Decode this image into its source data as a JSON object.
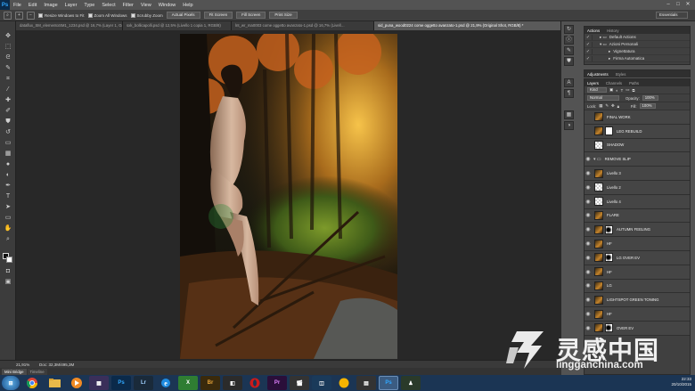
{
  "app": {
    "logo": "Ps"
  },
  "menu": [
    "File",
    "Edit",
    "Image",
    "Layer",
    "Type",
    "Select",
    "Filter",
    "View",
    "Window",
    "Help"
  ],
  "window_controls": {
    "minimize": "–",
    "maximize": "□",
    "close": "✕"
  },
  "options": {
    "resize_label": "Resize Windows to Fit",
    "zoom_all_label": "Zoom All Windows",
    "scrubby_label": "Scrubby Zoom",
    "actual_pixels": "Actual Pixels",
    "fit_screen": "Fit Screen",
    "fill_screen": "Fill Screen",
    "print_size": "Print Size",
    "workspace": "Essentials"
  },
  "tabs": [
    {
      "label": "dataflux_SM_elementoSM1_1234.psd @ 16,7% (Layer 1, Gray/8)",
      "active": false
    },
    {
      "label": "sxk_bollicapolli.psd @ 12,5% (Livello 1 copia 1, RGB/8)",
      "active": false
    },
    {
      "label": "lnt_wr_ma0003 come oggetto avanzato-1.psd @ 16,7% (Livell…",
      "active": false
    },
    {
      "label": "sid_puna_wood0224 come oggetto avanzato-1.psd @ 21,9% (Original Shot, RGB/8) *",
      "active": true
    }
  ],
  "status": {
    "zoom": "21,91%",
    "doc": "Doc: 32,3M/495,3M"
  },
  "bottom_tabs": [
    {
      "label": "Mini Bridge",
      "active": true
    },
    {
      "label": "Timeline",
      "active": false
    }
  ],
  "actions_panel": {
    "tabs": [
      "Actions",
      "History"
    ],
    "rows": [
      {
        "label": "Default Actions",
        "level": 0,
        "expanded": false
      },
      {
        "label": "Azioni Personali",
        "level": 0,
        "expanded": true
      },
      {
        "label": "Vignettatura",
        "level": 1,
        "expanded": false
      },
      {
        "label": "Firma Automatica",
        "level": 1,
        "expanded": false
      }
    ]
  },
  "adjust_tabs": [
    "Adjustments",
    "Styles"
  ],
  "layers_panel": {
    "tabs": [
      "Layers",
      "Channels",
      "Paths"
    ],
    "kind": "Kind",
    "blend_mode": "Normal",
    "opacity_label": "Opacity:",
    "opacity": "100%",
    "lock_label": "Lock:",
    "fill_label": "Fill:",
    "fill": "100%",
    "layers": [
      {
        "name": "FINAL WORK",
        "thumb": "photo",
        "mask": false,
        "visible": false,
        "group": false
      },
      {
        "name": "LEG REBUILD",
        "thumb": "photo",
        "mask": true,
        "visible": false,
        "group": false
      },
      {
        "name": "SHADOW",
        "thumb": "checker",
        "mask": false,
        "visible": false,
        "group": false
      },
      {
        "name": "REMOVE SLIP",
        "thumb": "folder",
        "mask": false,
        "visible": true,
        "group": true
      },
      {
        "name": "Livello 3",
        "thumb": "photo",
        "mask": false,
        "visible": true,
        "group": false
      },
      {
        "name": "Livello 2",
        "thumb": "checker",
        "mask": false,
        "visible": true,
        "group": false
      },
      {
        "name": "Livello 4",
        "thumb": "checker",
        "mask": false,
        "visible": true,
        "group": false
      },
      {
        "name": "FLARE",
        "thumb": "photo",
        "mask": false,
        "visible": true,
        "group": false
      },
      {
        "name": "AUTUMN FEELING",
        "thumb": "photo",
        "mask": true,
        "visible": true,
        "group": false
      },
      {
        "name": "HF",
        "thumb": "photo",
        "mask": false,
        "visible": true,
        "group": false
      },
      {
        "name": "LG OVER EV",
        "thumb": "photo",
        "mask": true,
        "visible": true,
        "group": false
      },
      {
        "name": "HF",
        "thumb": "photo",
        "mask": false,
        "visible": true,
        "group": false
      },
      {
        "name": "LG",
        "thumb": "photo",
        "mask": false,
        "visible": true,
        "group": false
      },
      {
        "name": "LIGHTSPOT GREEN TONING",
        "thumb": "photo",
        "mask": false,
        "visible": true,
        "group": false
      },
      {
        "name": "HF",
        "thumb": "photo",
        "mask": false,
        "visible": true,
        "group": false
      },
      {
        "name": "OVER EV",
        "thumb": "photo",
        "mask": true,
        "visible": true,
        "group": false
      }
    ]
  },
  "taskbar": {
    "apps": [
      "Ps",
      "Lr",
      "Br",
      "Pr",
      "Ps"
    ],
    "time": "22:33",
    "date": "20/10/2015"
  },
  "watermark": {
    "cn": "灵感中国",
    "en": "lingganchina.com"
  },
  "colors": {
    "accent": "#31a8ff",
    "panel": "#404040",
    "taskbar": "#1b3554"
  }
}
